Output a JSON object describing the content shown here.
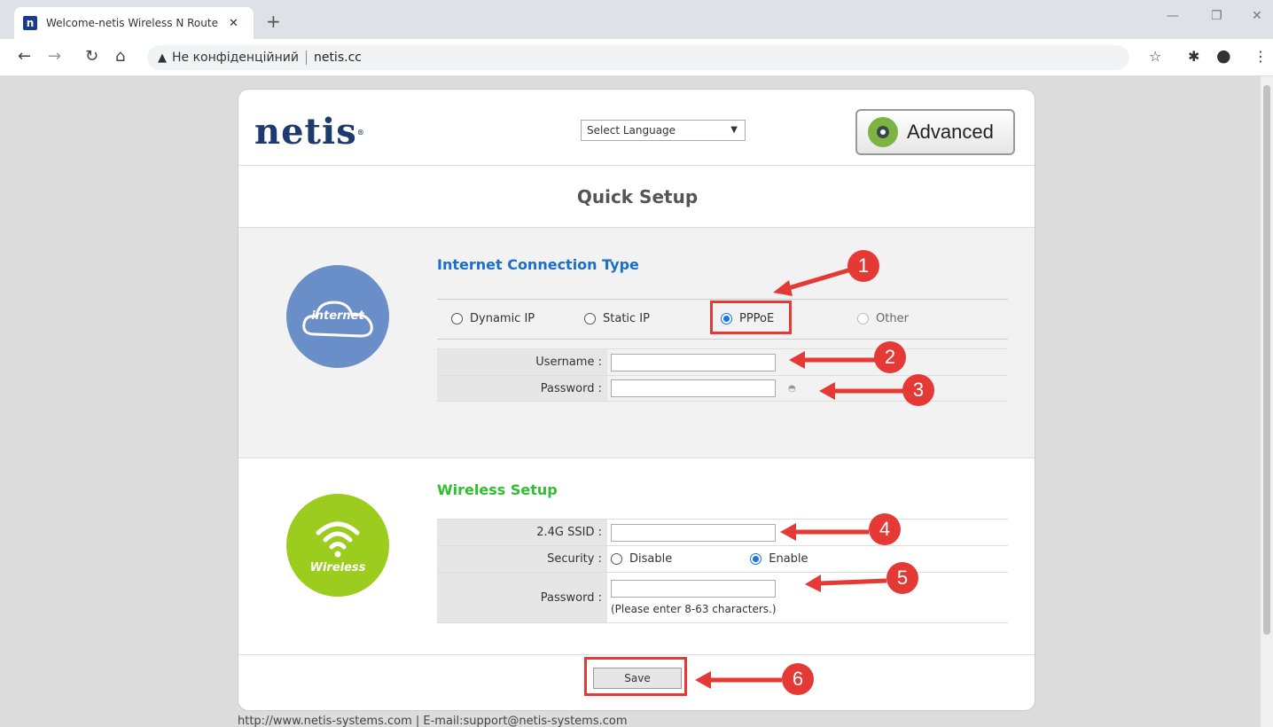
{
  "browser": {
    "tab_title": "Welcome-netis Wireless N Route",
    "tab_favicon": "n",
    "tab_close": "✕",
    "new_tab": "+",
    "security_label": "Не конфіденційний",
    "url": "netis.cc",
    "icons": [
      "back-icon",
      "forward-icon",
      "reload-icon",
      "home-icon",
      "warning-icon",
      "star-icon",
      "extensions-icon",
      "profile-icon",
      "menu-icon"
    ]
  },
  "header": {
    "logo": "netis",
    "logo_mark": "®",
    "language_select": "Select Language",
    "advanced_button": "Advanced"
  },
  "page": {
    "title": "Quick Setup"
  },
  "internet": {
    "icon_label": "internet",
    "heading": "Internet Connection Type",
    "heading_color": "#1a6fc9",
    "options": [
      "Dynamic IP",
      "Static IP",
      "PPPoE",
      "Other"
    ],
    "selected": "PPPoE",
    "username_label": "Username :",
    "password_label": "Password :"
  },
  "wireless": {
    "icon_label": "Wireless",
    "heading": "Wireless Setup",
    "heading_color": "#2fbf2f",
    "ssid_label": "2.4G SSID :",
    "security_label": "Security :",
    "security_options": [
      "Disable",
      "Enable"
    ],
    "security_selected": "Enable",
    "password_label": "Password :",
    "password_hint": "(Please enter 8-63 characters.)"
  },
  "footer": {
    "save_button": "Save",
    "contact": "http://www.netis-systems.com | E-mail:support@netis-systems.com"
  },
  "annotations": [
    "1",
    "2",
    "3",
    "4",
    "5",
    "6"
  ],
  "annotation_color": "#e53935"
}
